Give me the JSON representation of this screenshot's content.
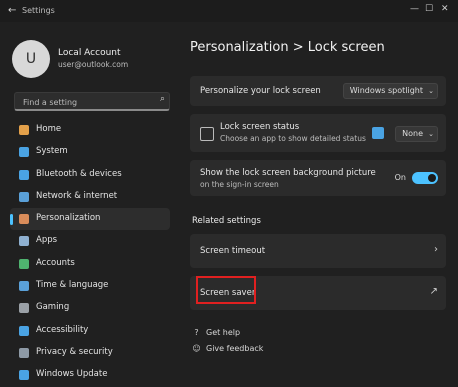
{
  "window": {
    "app_title": "Settings",
    "back_glyph": "←",
    "controls": [
      "—",
      "☐",
      "✕"
    ]
  },
  "profile": {
    "initials": "U",
    "name": "Local Account",
    "email": "user@outlook.com"
  },
  "search": {
    "placeholder": "Find a setting",
    "icon": "search-icon"
  },
  "sidebar": {
    "items": [
      {
        "label": "Home",
        "icon_color": "#e3a04a"
      },
      {
        "label": "System",
        "icon_color": "#4aa3e3"
      },
      {
        "label": "Bluetooth & devices",
        "icon_color": "#4aa3e3"
      },
      {
        "label": "Network & internet",
        "icon_color": "#5aa0d8"
      },
      {
        "label": "Personalization",
        "icon_color": "#d98c5a",
        "active": true
      },
      {
        "label": "Apps",
        "icon_color": "#8fb0d0"
      },
      {
        "label": "Accounts",
        "icon_color": "#4fb36f"
      },
      {
        "label": "Time & language",
        "icon_color": "#5aa0d8"
      },
      {
        "label": "Gaming",
        "icon_color": "#9aa0a6"
      },
      {
        "label": "Accessibility",
        "icon_color": "#4aa3e3"
      },
      {
        "label": "Privacy & security",
        "icon_color": "#8e9aa6"
      },
      {
        "label": "Windows Update",
        "icon_color": "#4aa3e3"
      }
    ]
  },
  "main": {
    "title": "Personalization  >  Lock screen",
    "personalize_row": {
      "label": "Personalize your lock screen",
      "value": "Windows spotlight"
    },
    "status_row": {
      "label": "Lock screen status",
      "sublabel": "Choose an app to show detailed status",
      "value": "None"
    },
    "signin_row": {
      "label": "Show the lock screen background picture",
      "label2": "on the sign-in screen",
      "toggle_text": "On",
      "toggle_on": true
    },
    "related_heading": "Related settings",
    "screen_timeout_row": {
      "label": "Screen timeout"
    },
    "screen_saver_row": {
      "label": "Screen saver"
    },
    "footer": {
      "get_help": "Get help",
      "give_feedback": "Give feedback"
    }
  },
  "accent_color": "#4cc2ff",
  "highlight_color": "#e02020"
}
